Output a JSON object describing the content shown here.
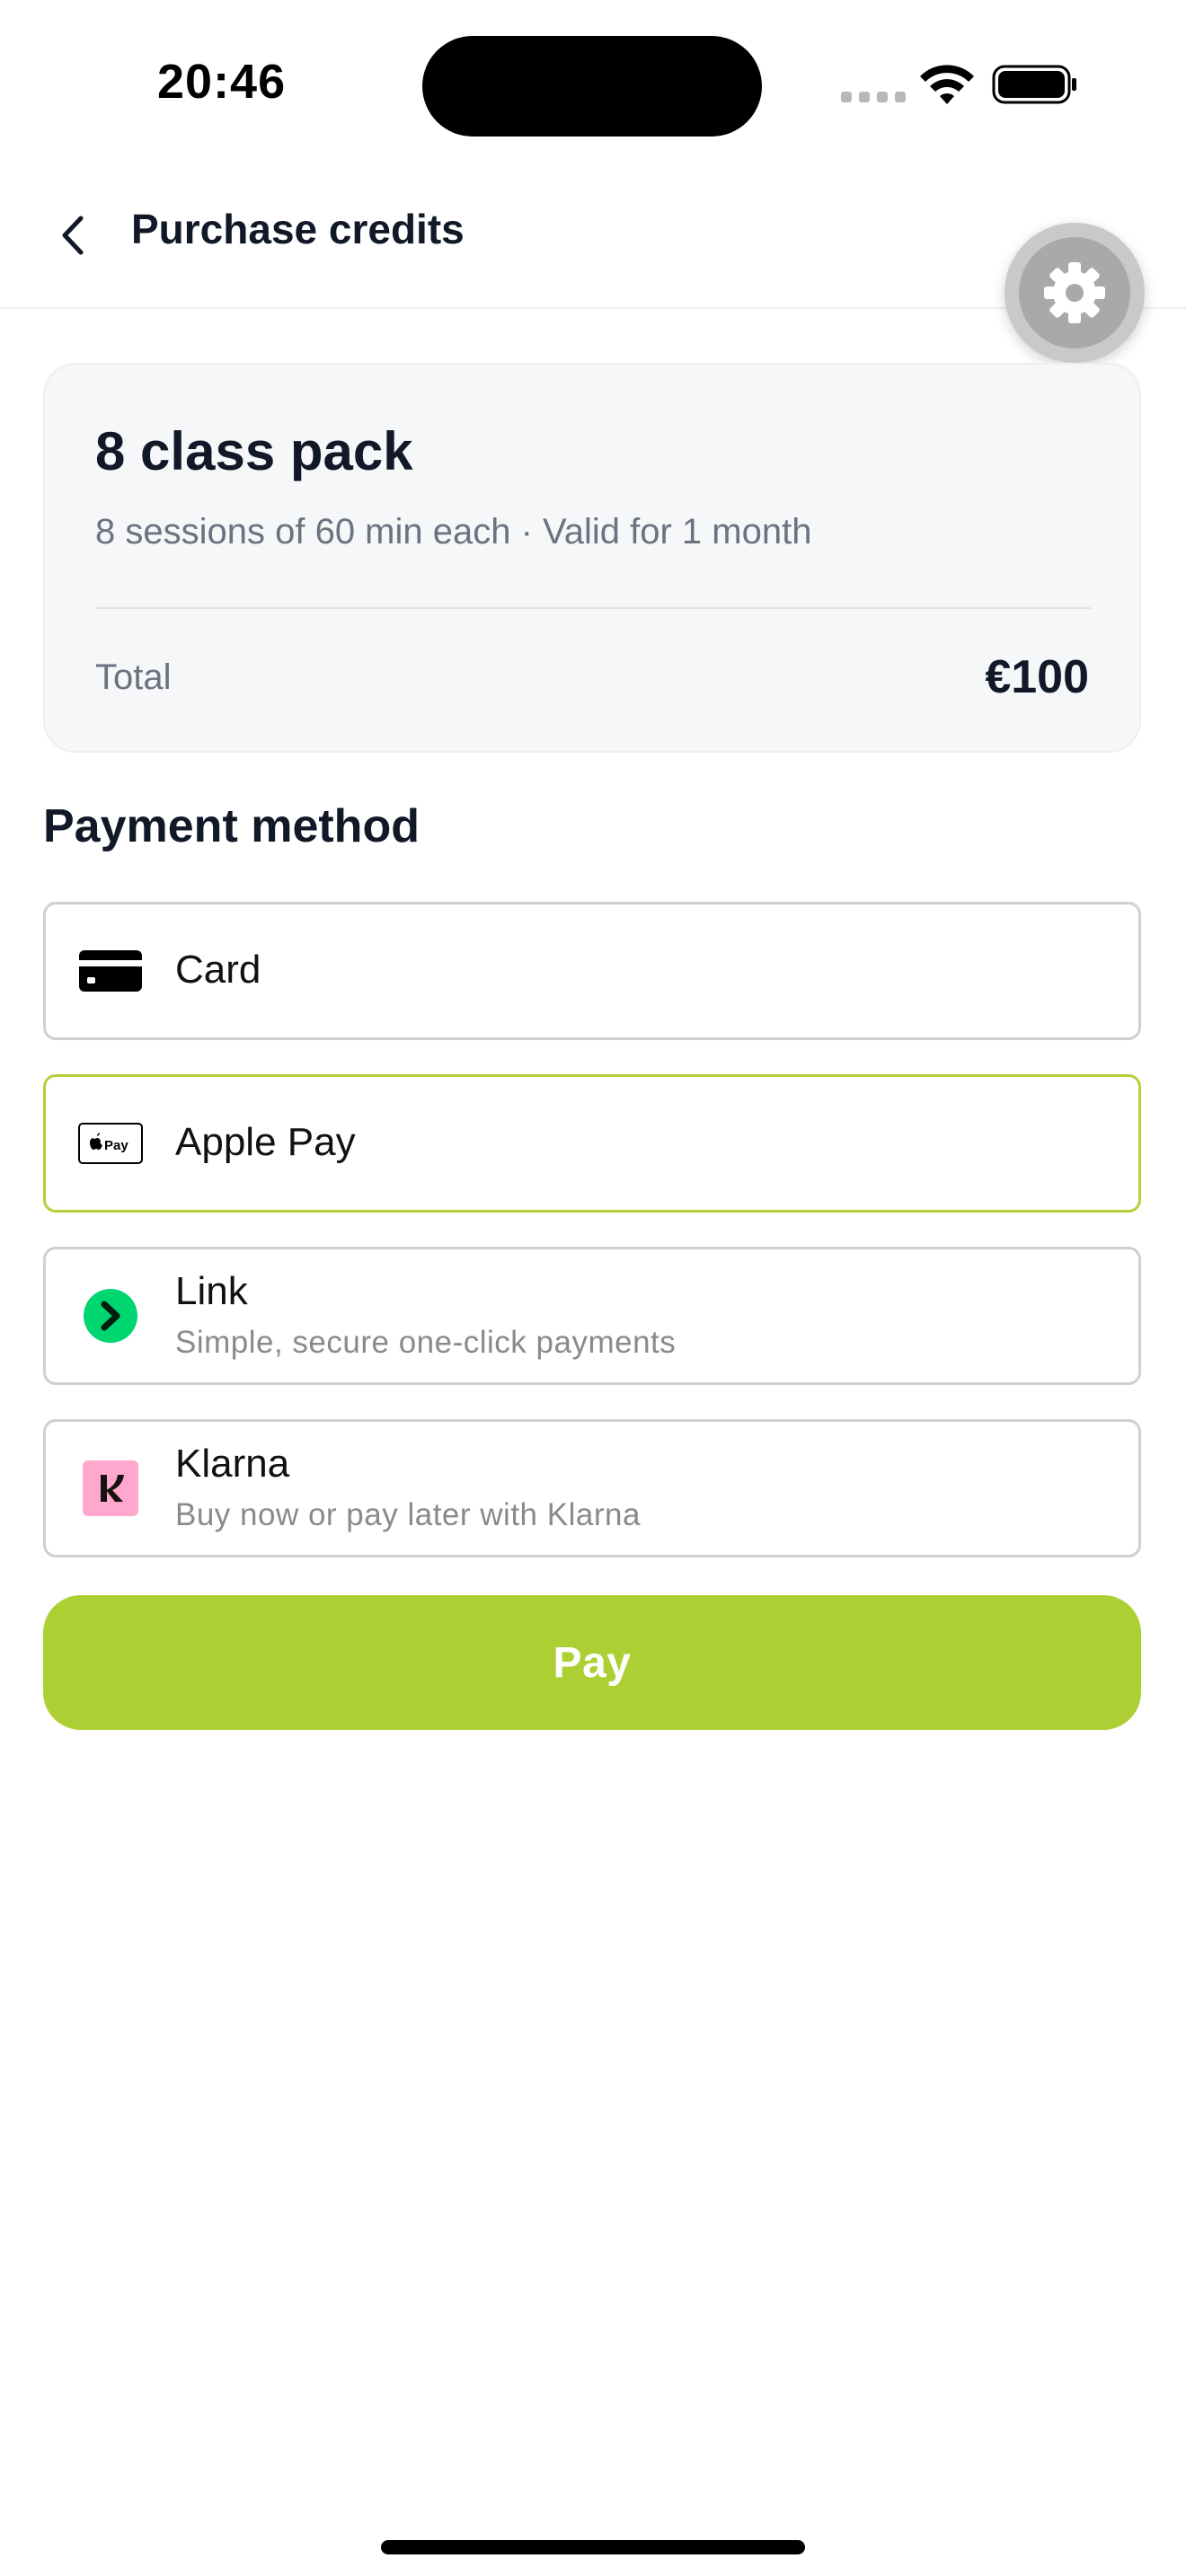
{
  "status_bar": {
    "time": "20:46"
  },
  "header": {
    "title": "Purchase credits",
    "back_icon": "chevron-left-icon",
    "settings_icon": "gear-icon"
  },
  "summary": {
    "pack_name": "8 class pack",
    "description": "8 sessions of 60 min each · Valid for 1 month",
    "total_label": "Total",
    "total_value": "€100"
  },
  "payment": {
    "section_title": "Payment method",
    "methods": [
      {
        "label": "Card",
        "subtitle": "",
        "icon": "credit-card-icon",
        "selected": false
      },
      {
        "label": "Apple Pay",
        "subtitle": "",
        "icon": "apple-pay-icon",
        "selected": true
      },
      {
        "label": "Link",
        "subtitle": "Simple, secure one-click payments",
        "icon": "link-icon",
        "selected": false
      },
      {
        "label": "Klarna",
        "subtitle": "Buy now or pay later with Klarna",
        "icon": "klarna-icon",
        "selected": false
      }
    ],
    "pay_label": "Pay"
  },
  "colors": {
    "accent": "#acd033",
    "selected_border": "#b3d23a",
    "link_green": "#00d66f",
    "klarna_pink": "#ffa8cd"
  }
}
